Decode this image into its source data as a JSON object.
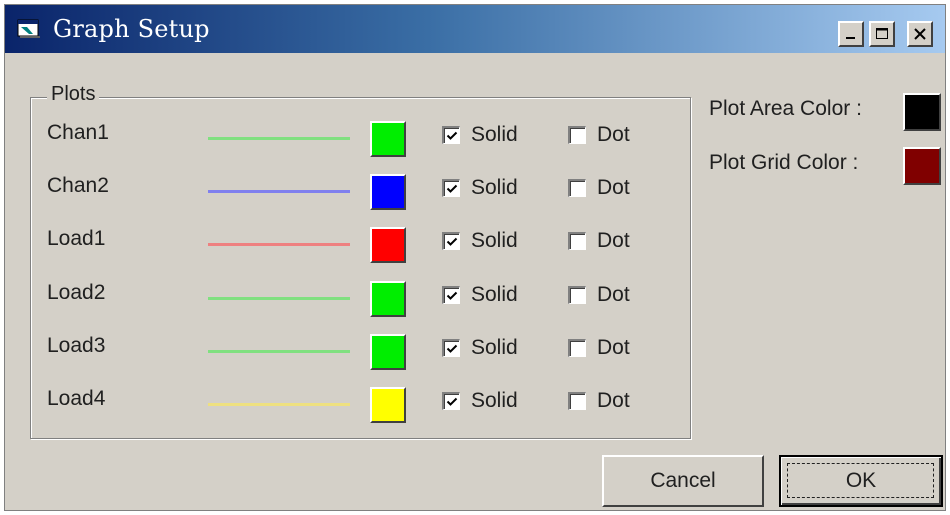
{
  "window": {
    "title": "Graph Setup",
    "icon": "app-window-icon",
    "controls": {
      "minimize_icon": "minimize-icon",
      "maximize_icon": "maximize-icon",
      "close_icon": "close-icon"
    }
  },
  "plots": {
    "group_title": "Plots",
    "solid_label": "Solid",
    "dot_label": "Dot",
    "rows": [
      {
        "name": "Chan1",
        "line_color": "#80e080",
        "swatch_color": "#00ee00",
        "solid": true,
        "dot": false
      },
      {
        "name": "Chan2",
        "line_color": "#8080ee",
        "swatch_color": "#0000ff",
        "solid": true,
        "dot": false
      },
      {
        "name": "Load1",
        "line_color": "#ee8080",
        "swatch_color": "#ff0000",
        "solid": true,
        "dot": false
      },
      {
        "name": "Load2",
        "line_color": "#80e080",
        "swatch_color": "#00ee00",
        "solid": true,
        "dot": false
      },
      {
        "name": "Load3",
        "line_color": "#80e080",
        "swatch_color": "#00ee00",
        "solid": true,
        "dot": false
      },
      {
        "name": "Load4",
        "line_color": "#eee080",
        "swatch_color": "#ffff00",
        "solid": true,
        "dot": false
      }
    ]
  },
  "settings": {
    "plot_area_label": "Plot Area Color :",
    "plot_area_color": "#000000",
    "plot_grid_label": "Plot Grid Color :",
    "plot_grid_color": "#800000"
  },
  "buttons": {
    "cancel": "Cancel",
    "ok": "OK"
  }
}
